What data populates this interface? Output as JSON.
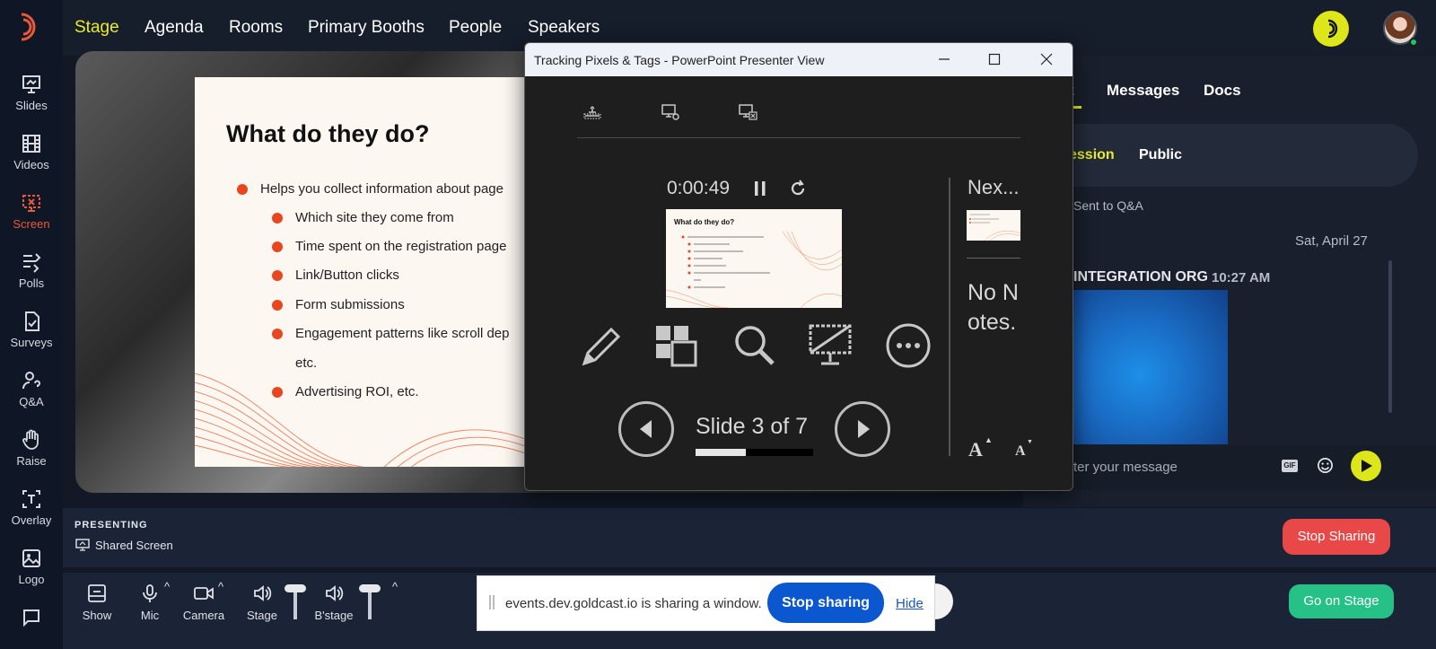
{
  "nav": {
    "items": [
      "Stage",
      "Agenda",
      "Rooms",
      "Primary Booths",
      "People",
      "Speakers"
    ],
    "active": "Stage"
  },
  "sidebar": {
    "items": [
      {
        "label": "Slides",
        "icon": "slides-icon"
      },
      {
        "label": "Videos",
        "icon": "film-icon"
      },
      {
        "label": "Screen",
        "icon": "screen-share-icon",
        "active": true
      },
      {
        "label": "Polls",
        "icon": "polls-icon"
      },
      {
        "label": "Surveys",
        "icon": "survey-icon"
      },
      {
        "label": "Q&A",
        "icon": "question-person-icon"
      },
      {
        "label": "Raise",
        "icon": "hand-icon"
      },
      {
        "label": "Overlay",
        "icon": "overlay-icon"
      },
      {
        "label": "Logo",
        "icon": "image-icon"
      }
    ]
  },
  "slide": {
    "title": "What do they do?",
    "bullets": [
      "Helps you collect information about page",
      "Which site they come from",
      "Time spent on the registration page",
      "Link/Button clicks",
      "Form submissions",
      "Engagement patterns like scroll dep",
      "etc.",
      "Advertising ROI, etc."
    ]
  },
  "presenter": {
    "window_title": "Tracking Pixels & Tags - PowerPoint Presenter View",
    "timer": "0:00:49",
    "slide_counter": "Slide 3 of 7",
    "progress": 0.43,
    "next_label": "Nex...",
    "notes": "No Notes.",
    "thumb_title": "What do they do?",
    "font_increase": "A",
    "font_decrease": "A"
  },
  "right_panel": {
    "tabs": [
      "t",
      "Messages",
      "Docs"
    ],
    "active_tab": "t",
    "pills": [
      "ession",
      "Public"
    ],
    "active_pill": "ession",
    "sent_note": "Sent to Q&A",
    "date": "Sat, April 27",
    "message": {
      "org": "INTEGRATION ORG",
      "time": "10:27 AM"
    },
    "input_placeholder": "ter your message",
    "gif_label": "GIF"
  },
  "presenting": {
    "label": "PRESENTING",
    "source": "Shared Screen",
    "stop_label": "Stop Sharing"
  },
  "toolbar": {
    "show": "Show",
    "mic": "Mic",
    "camera": "Camera",
    "stage": "Stage",
    "backstage": "B'stage",
    "go_on_stage": "Go on Stage"
  },
  "share_banner": {
    "text": "events.dev.goldcast.io is sharing a window.",
    "stop": "Stop sharing",
    "hide": "Hide"
  },
  "colors": {
    "accent_yellow": "#e9ec27",
    "brand_orange": "#e8593a",
    "stop_red": "#e84848",
    "go_green": "#25c187",
    "chrome_blue": "#0b57d0"
  }
}
